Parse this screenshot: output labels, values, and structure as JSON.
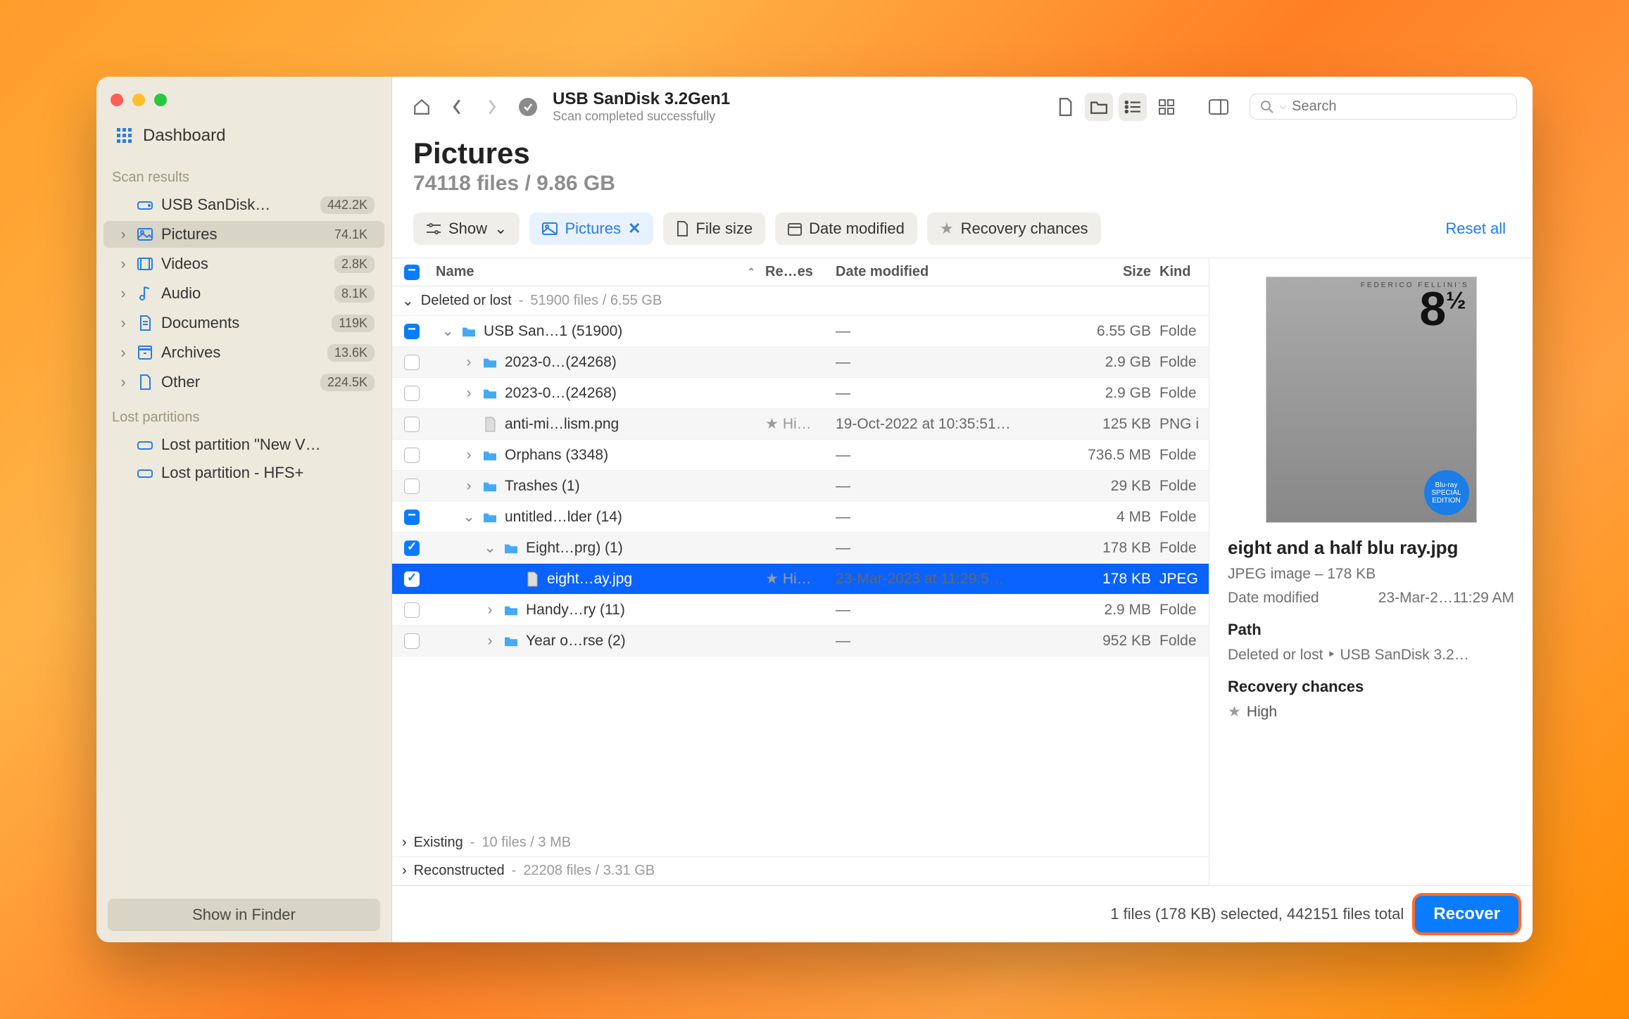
{
  "sidebar": {
    "dashboard_label": "Dashboard",
    "scan_results_label": "Scan results",
    "items": [
      {
        "label": "USB  SanDisk…",
        "badge": "442.2K",
        "icon": "drive"
      },
      {
        "label": "Pictures",
        "badge": "74.1K",
        "icon": "picture",
        "active": true
      },
      {
        "label": "Videos",
        "badge": "2.8K",
        "icon": "video"
      },
      {
        "label": "Audio",
        "badge": "8.1K",
        "icon": "audio"
      },
      {
        "label": "Documents",
        "badge": "119K",
        "icon": "document"
      },
      {
        "label": "Archives",
        "badge": "13.6K",
        "icon": "archive"
      },
      {
        "label": "Other",
        "badge": "224.5K",
        "icon": "other"
      }
    ],
    "lost_partitions_label": "Lost partitions",
    "lost_items": [
      {
        "label": "Lost partition \"New V…"
      },
      {
        "label": "Lost partition - HFS+"
      }
    ],
    "show_in_finder": "Show in Finder"
  },
  "toolbar": {
    "title": "USB  SanDisk 3.2Gen1",
    "subtitle": "Scan completed successfully",
    "search_placeholder": "Search"
  },
  "page": {
    "title": "Pictures",
    "subtitle": "74118 files / 9.86 GB"
  },
  "filters": {
    "show": "Show",
    "pictures": "Pictures",
    "file_size": "File size",
    "date_modified": "Date modified",
    "recovery": "Recovery chances",
    "reset": "Reset all"
  },
  "table": {
    "header": {
      "name": "Name",
      "recovery": "Re…es",
      "date": "Date modified",
      "size": "Size",
      "kind": "Kind"
    },
    "group_deleted": {
      "label": "Deleted or lost",
      "meta": "51900 files / 6.55 GB"
    },
    "group_existing": {
      "label": "Existing",
      "meta": "10 files / 3 MB"
    },
    "group_reconstructed": {
      "label": "Reconstructed",
      "meta": "22208 files / 3.31 GB"
    },
    "rows": [
      {
        "indent": 0,
        "cb": "on",
        "disc": "down",
        "icon": "folder",
        "name": "USB  San…1 (51900)",
        "date": "—",
        "size": "6.55 GB",
        "kind": "Folde"
      },
      {
        "indent": 1,
        "cb": "off",
        "disc": "right",
        "icon": "folder",
        "name": "2023-0…(24268)",
        "date": "—",
        "size": "2.9 GB",
        "kind": "Folde",
        "alt": true
      },
      {
        "indent": 1,
        "cb": "off",
        "disc": "right",
        "icon": "folder",
        "name": "2023-0…(24268)",
        "date": "—",
        "size": "2.9 GB",
        "kind": "Folde"
      },
      {
        "indent": 1,
        "cb": "off",
        "disc": "",
        "icon": "file",
        "name": "anti-mi…lism.png",
        "rec": "Hi…",
        "date": "19-Oct-2022 at 10:35:51…",
        "size": "125 KB",
        "kind": "PNG i",
        "alt": true
      },
      {
        "indent": 1,
        "cb": "off",
        "disc": "right",
        "icon": "folder",
        "name": "Orphans (3348)",
        "date": "—",
        "size": "736.5 MB",
        "kind": "Folde"
      },
      {
        "indent": 1,
        "cb": "off",
        "disc": "right",
        "icon": "folder",
        "name": "Trashes (1)",
        "date": "—",
        "size": "29 KB",
        "kind": "Folde",
        "alt": true
      },
      {
        "indent": 1,
        "cb": "on",
        "disc": "down",
        "icon": "folder",
        "name": "untitled…lder (14)",
        "date": "—",
        "size": "4 MB",
        "kind": "Folde"
      },
      {
        "indent": 2,
        "cb": "check",
        "disc": "down",
        "icon": "folder",
        "name": "Eight…prg) (1)",
        "date": "—",
        "size": "178 KB",
        "kind": "Folde",
        "alt": true
      },
      {
        "indent": 3,
        "cb": "check",
        "disc": "",
        "icon": "file",
        "name": "eight…ay.jpg",
        "rec": "Hi…",
        "date": "23-Mar-2023 at 11:29:5…",
        "size": "178 KB",
        "kind": "JPEG",
        "sel": true
      },
      {
        "indent": 2,
        "cb": "off",
        "disc": "right",
        "icon": "folder",
        "name": "Handy…ry (11)",
        "date": "—",
        "size": "2.9 MB",
        "kind": "Folde"
      },
      {
        "indent": 2,
        "cb": "off",
        "disc": "right",
        "icon": "folder",
        "name": "Year o…rse (2)",
        "date": "—",
        "size": "952 KB",
        "kind": "Folde",
        "alt": true
      }
    ]
  },
  "details": {
    "filename": "eight and a half blu ray.jpg",
    "kind_size": "JPEG image – 178 KB",
    "date_label": "Date modified",
    "date_value": "23-Mar-2…11:29 AM",
    "path_label": "Path",
    "path_value": "Deleted or lost ‣ USB  SanDisk 3.2…",
    "recovery_label": "Recovery chances",
    "recovery_value": "High",
    "preview_criterion": "FEDERICO FELLINI'S",
    "preview_number": "8",
    "preview_half": "½",
    "preview_bluray": "Blu-ray SPECIAL EDITION"
  },
  "status": {
    "text": "1 files (178 KB) selected, 442151 files total",
    "recover": "Recover"
  }
}
